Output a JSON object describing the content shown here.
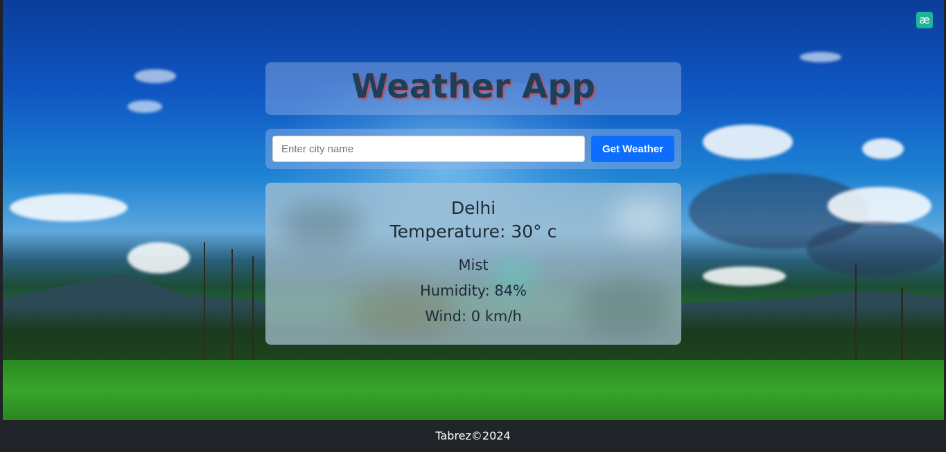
{
  "header": {
    "title": "Weather App",
    "corner_icon": "æ"
  },
  "search": {
    "placeholder": "Enter city name",
    "value": "",
    "button_label": "Get Weather"
  },
  "weather": {
    "city": "Delhi",
    "temperature": "Temperature: 30° c",
    "condition": "Mist",
    "humidity": "Humidity: 84%",
    "wind": "Wind: 0 km/h"
  },
  "footer": {
    "text": "Tabrez©2024"
  },
  "colors": {
    "button": "#0d6efd",
    "title_text": "#1e3f5a",
    "title_shadow": "#d14545",
    "footer_bg": "#212529",
    "corner_icon_bg": "#1fb39a"
  },
  "icons": {
    "corner": "extension-ae-icon"
  }
}
